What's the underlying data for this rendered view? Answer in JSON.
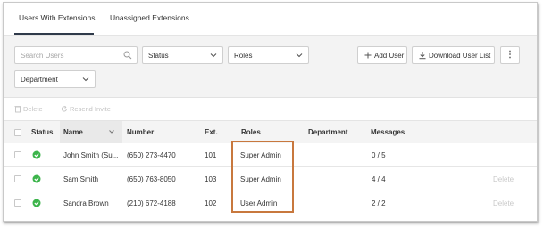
{
  "tabs": [
    {
      "label": "Users With Extensions",
      "active": true
    },
    {
      "label": "Unassigned Extensions",
      "active": false
    }
  ],
  "filters": {
    "search_placeholder": "Search Users",
    "status_label": "Status",
    "roles_label": "Roles",
    "department_label": "Department",
    "add_user_label": "Add User",
    "download_label": "Download User List",
    "more_label": "⋮"
  },
  "toolbar": {
    "delete_label": "Delete",
    "resend_label": "Resend Invite"
  },
  "table": {
    "columns": [
      "Status",
      "Name",
      "Number",
      "Ext.",
      "Roles",
      "Department",
      "Messages"
    ],
    "rows": [
      {
        "name": "John Smith (Su...",
        "number": "(650) 273-4470",
        "ext": "101",
        "role": "Super Admin",
        "department": "",
        "messages": "0 / 5",
        "action": ""
      },
      {
        "name": "Sam Smith",
        "number": "(650) 763-8050",
        "ext": "103",
        "role": "Super Admin",
        "department": "",
        "messages": "4 / 4",
        "action": "Delete"
      },
      {
        "name": "Sandra Brown",
        "number": "(210) 672-4188",
        "ext": "102",
        "role": "User Admin",
        "department": "",
        "messages": "2 / 2",
        "action": "Delete"
      }
    ]
  },
  "colors": {
    "status_ok": "#3cb44b",
    "highlight": "#c8783e",
    "tab_underline": "#2f3a4a"
  }
}
